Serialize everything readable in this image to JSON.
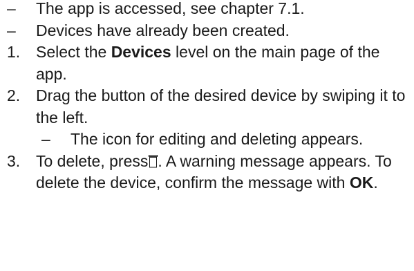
{
  "prereq": [
    {
      "marker": "–",
      "text": "The app is accessed, see chapter 7.1."
    },
    {
      "marker": "–",
      "text": "Devices have already been created."
    }
  ],
  "steps": [
    {
      "marker": "1.",
      "before": "Select the ",
      "bold": "Devices",
      "after": " level on the main page of the app."
    },
    {
      "marker": "2.",
      "text": "Drag the button of the desired device by swiping it to the left."
    },
    {
      "marker": "3.",
      "before": "To delete, press",
      "icon": "trash-icon",
      "after": ". A warning message appears. To delete the device, confirm the message with ",
      "bold": "OK",
      "end": "."
    }
  ],
  "result": {
    "marker": "–",
    "text": "The icon for editing and deleting appears."
  }
}
